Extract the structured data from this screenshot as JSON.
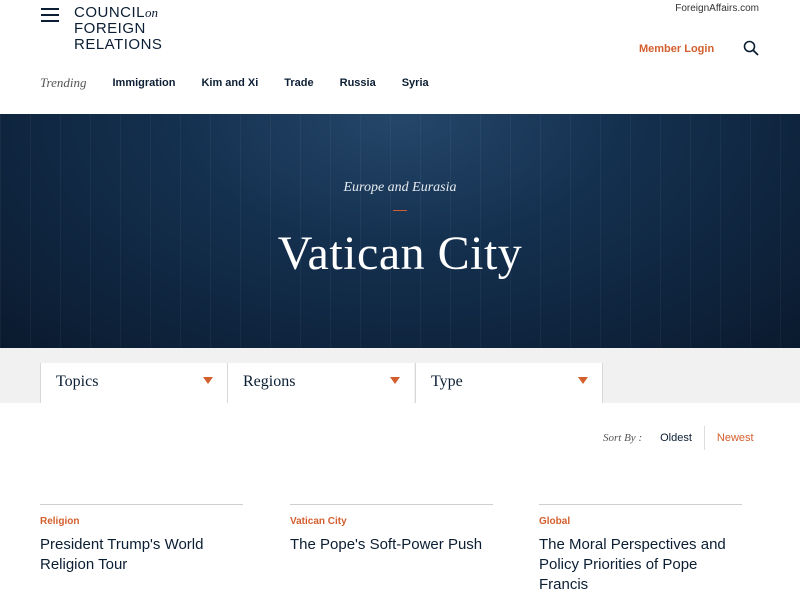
{
  "header": {
    "logo_line1": "COUNCIL",
    "logo_on": "on",
    "logo_line2": "FOREIGN",
    "logo_line3": "RELATIONS",
    "foreign_affairs_link": "ForeignAffairs.com",
    "member_login": "Member Login",
    "trending_label": "Trending",
    "trending_items": [
      "Immigration",
      "Kim and Xi",
      "Trade",
      "Russia",
      "Syria"
    ]
  },
  "hero": {
    "region": "Europe and Eurasia",
    "title": "Vatican City"
  },
  "filters": {
    "topics": "Topics",
    "regions": "Regions",
    "type": "Type"
  },
  "sort": {
    "label": "Sort By :",
    "oldest": "Oldest",
    "newest": "Newest"
  },
  "cards": [
    {
      "category": "Religion",
      "headline": "President Trump's World Religion Tour"
    },
    {
      "category": "Vatican City",
      "headline": "The Pope's Soft-Power Push"
    },
    {
      "category": "Global",
      "headline": "The Moral Perspectives and Policy Priorities of Pope Francis"
    }
  ],
  "colors": {
    "accent": "#d35f2e",
    "navy": "#0b1e33"
  }
}
